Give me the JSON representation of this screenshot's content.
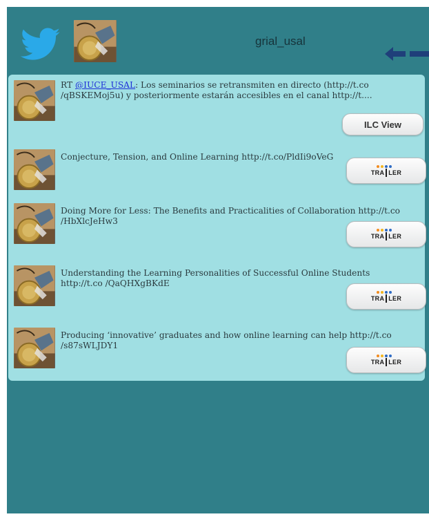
{
  "header": {
    "username": "grial_usal",
    "icons": {
      "logo": "twitter-bird-icon",
      "back": "back-arrow-icon"
    },
    "colors": {
      "bird": "#2aa9e8",
      "arrow": "#1f3f7a"
    }
  },
  "tweets": [
    {
      "text_prefix": "RT ",
      "mention": "@IUCE_USAL",
      "text": ": Los seminarios se retransmiten en directo (http://t.co /qBSKEMoj5u) y posteriormente estarán accesibles en el canal http://t....",
      "button_label": "ILC View"
    },
    {
      "text": "Conjecture, Tension, and Online Learning http://t.co/PldIi9oVeG",
      "button_logo": "TRA|LER"
    },
    {
      "text": "Doing More for Less: The Benefits and Practicalities of Collaboration http://t.co /HbXlcJeHw3",
      "button_logo": "TRA|LER"
    },
    {
      "text": "Understanding the Learning Personalities of Successful Online Students http://t.co /QaQHXgBKdE",
      "button_logo": "TRA|LER"
    },
    {
      "text": "Producing ‘innovative’ graduates and how online learning can help http://t.co /s87sWLJDY1",
      "button_logo": "TRA|LER"
    }
  ],
  "trailer_logo": {
    "left": "TRA",
    "right": "LER"
  },
  "colors": {
    "background": "#307f89",
    "timeline": "#a0dfe3",
    "link": "#1e2fd8"
  }
}
